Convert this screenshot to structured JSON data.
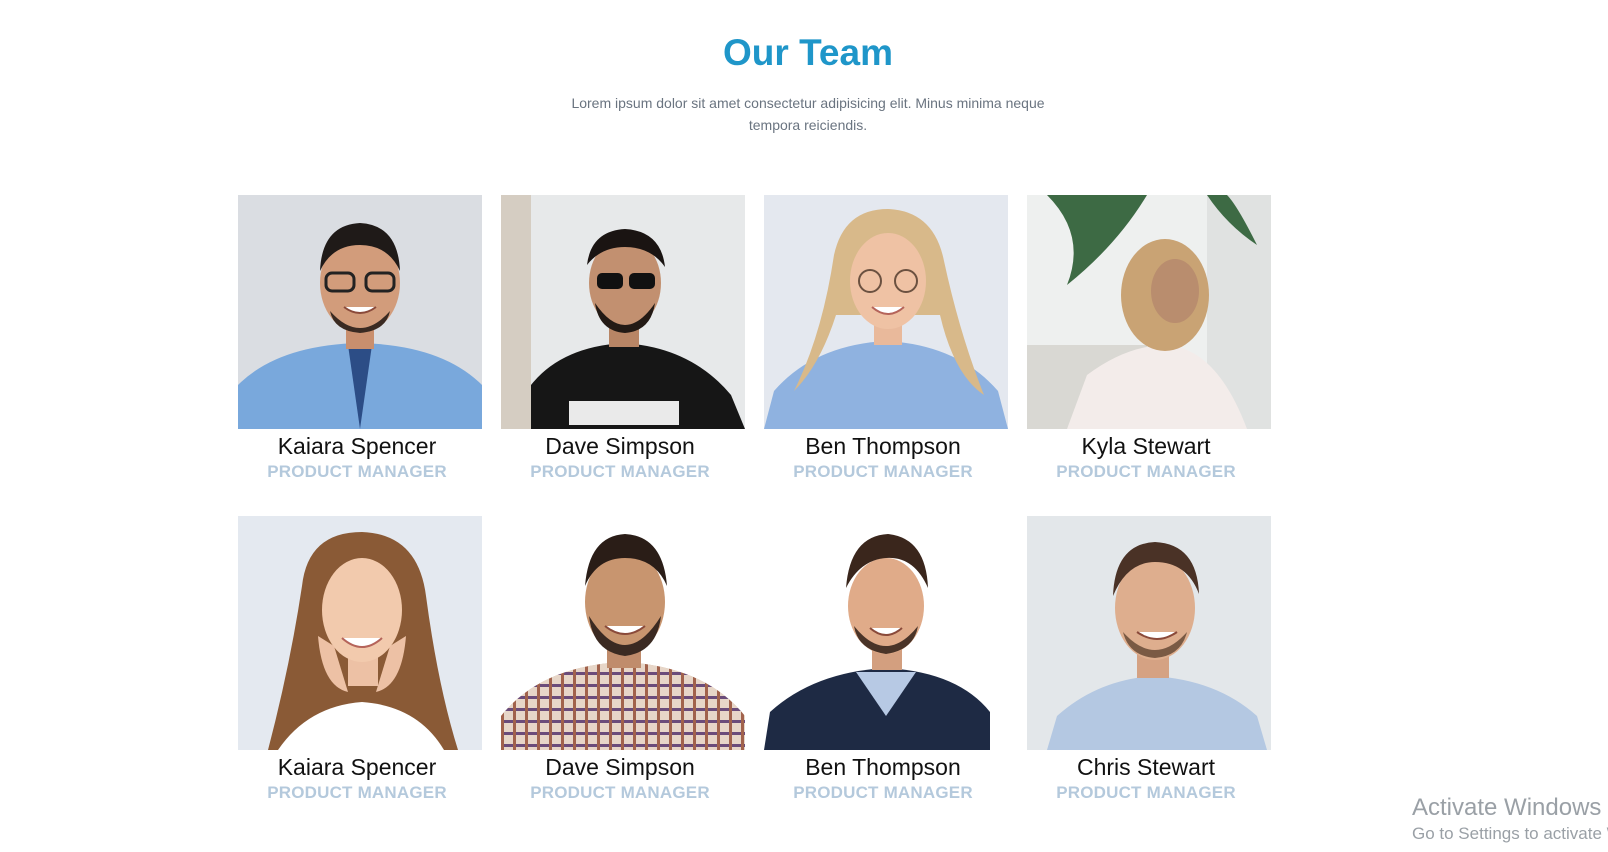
{
  "header": {
    "title": "Our Team",
    "subtitle": "Lorem ipsum dolor sit amet consectetur adipisicing elit. Minus minima neque tempora reiciendis."
  },
  "members": [
    {
      "name": "Kaiara Spencer",
      "role": "PRODUCT MANAGER"
    },
    {
      "name": "Dave Simpson",
      "role": "PRODUCT MANAGER"
    },
    {
      "name": "Ben Thompson",
      "role": "PRODUCT MANAGER"
    },
    {
      "name": "Kyla Stewart",
      "role": "PRODUCT MANAGER"
    },
    {
      "name": "Kaiara Spencer",
      "role": "PRODUCT MANAGER"
    },
    {
      "name": "Dave Simpson",
      "role": "PRODUCT MANAGER"
    },
    {
      "name": "Ben Thompson",
      "role": "PRODUCT MANAGER"
    },
    {
      "name": "Chris Stewart",
      "role": "PRODUCT MANAGER"
    }
  ],
  "watermark": {
    "title": "Activate Windows",
    "subtitle": "Go to Settings to activate Windows."
  },
  "colors": {
    "title": "#1f96c9",
    "subtitle": "#6a7480",
    "role": "#b4c9dc"
  }
}
